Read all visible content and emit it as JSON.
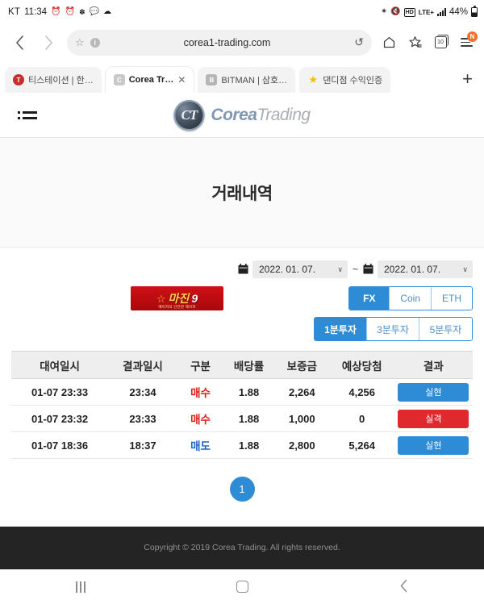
{
  "statusbar": {
    "carrier": "KT",
    "time": "11:34",
    "left_icons": [
      "alarm-icon",
      "alarm-icon",
      "bluetooth-sync-icon",
      "chat-icon",
      "cloud-icon"
    ],
    "right_icons": [
      "bluetooth-icon",
      "mute-icon"
    ],
    "hd_badge": "HD",
    "network": "LTE+",
    "battery_percent": "44%"
  },
  "browser": {
    "back_label": "‹",
    "forward_label": "›",
    "url": "corea1-trading.com",
    "info_label": "i",
    "reload_label": "↺",
    "home_label": "home-icon",
    "bookmarks_label": "bookmarks-icon",
    "tab_count": "10",
    "menu_badge": "N",
    "new_tab_label": "+",
    "tabs": [
      {
        "favicon": "T",
        "label": "티스테이션 | 한…",
        "active": false
      },
      {
        "favicon": "C",
        "label": "Corea Tr…",
        "active": true,
        "close_label": "✕"
      },
      {
        "favicon": "B",
        "label": "BITMAN | 삼호…",
        "active": false
      },
      {
        "favicon": "★",
        "label": "댄디점 수익인증",
        "active": false
      }
    ]
  },
  "site": {
    "menu_label": "menu-icon",
    "logo_mark": "CT",
    "brand_primary": "Corea",
    "brand_secondary": "Trading",
    "page_title": "거래내역"
  },
  "filters": {
    "date_from": "2022. 01. 07.",
    "date_to": "2022. 01. 07.",
    "range_separator": "~",
    "calendar_icon": "📅",
    "caret": "∨",
    "banner": {
      "emblem": "🦅",
      "title": "마진",
      "number": "9",
      "subtitle": "메이저의 안전한 메이저"
    },
    "market_tabs": [
      {
        "label": "FX",
        "selected": true
      },
      {
        "label": "Coin",
        "selected": false
      },
      {
        "label": "ETH",
        "selected": false
      }
    ],
    "duration_tabs": [
      {
        "label": "1분투자",
        "selected": true
      },
      {
        "label": "3분투자",
        "selected": false
      },
      {
        "label": "5분투자",
        "selected": false
      }
    ]
  },
  "table": {
    "headers": [
      "대여일시",
      "결과일시",
      "구분",
      "배당률",
      "보증금",
      "예상당첨",
      "결과"
    ],
    "rows": [
      {
        "open_time": "01-07 23:33",
        "close_time": "23:34",
        "side": "매수",
        "side_type": "buy",
        "payout": "1.88",
        "deposit": "2,264",
        "expected": "4,256",
        "result": "실현",
        "result_type": "win"
      },
      {
        "open_time": "01-07 23:32",
        "close_time": "23:33",
        "side": "매수",
        "side_type": "buy",
        "payout": "1.88",
        "deposit": "1,000",
        "expected": "0",
        "result": "실격",
        "result_type": "lose"
      },
      {
        "open_time": "01-07 18:36",
        "close_time": "18:37",
        "side": "매도",
        "side_type": "sell",
        "payout": "1.88",
        "deposit": "2,800",
        "expected": "5,264",
        "result": "실현",
        "result_type": "win"
      }
    ]
  },
  "pagination": {
    "current": "1"
  },
  "footer": {
    "copyright": "Copyright © 2019 Corea Trading. All rights reserved."
  },
  "navbar": {
    "recents": "recents-icon",
    "home": "home-icon",
    "back": "‹"
  },
  "colors": {
    "accent_blue": "#2e8bd6",
    "danger_red": "#e0292f",
    "buy_red": "#e21b1b",
    "sell_blue": "#1f5fd0",
    "footer_bg": "#242424"
  }
}
